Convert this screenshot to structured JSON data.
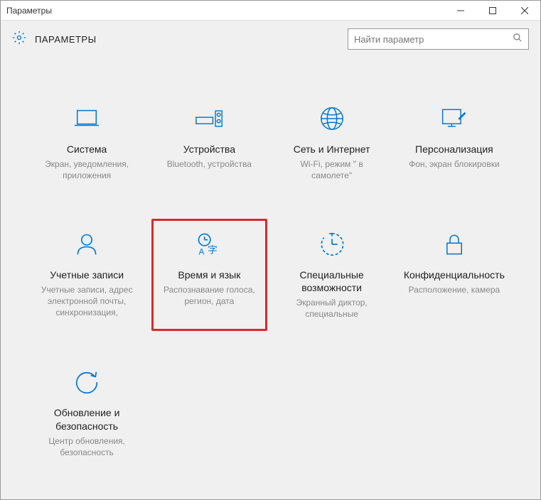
{
  "titlebar": {
    "title": "Параметры"
  },
  "header": {
    "title": "ПАРАМЕТРЫ"
  },
  "search": {
    "placeholder": "Найти параметр"
  },
  "tiles": {
    "system": {
      "title": "Система",
      "desc": "Экран, уведомления, приложения"
    },
    "devices": {
      "title": "Устройства",
      "desc": "Bluetooth, устройства"
    },
    "network": {
      "title": "Сеть и Интернет",
      "desc": "Wi-Fi, режим \" в самолете\""
    },
    "personalization": {
      "title": "Персонализация",
      "desc": "Фон, экран блокировки"
    },
    "accounts": {
      "title": "Учетные записи",
      "desc": "Учетные записи, адрес электронной почты, синхронизация,"
    },
    "time": {
      "title": "Время и язык",
      "desc": "Распознавание голоса, регион, дата"
    },
    "ease": {
      "title": "Специальные возможности",
      "desc": "Экранный диктор, специальные"
    },
    "privacy": {
      "title": "Конфиденциальность",
      "desc": "Расположение, камера"
    },
    "update": {
      "title": "Обновление и безопасность",
      "desc": "Центр обновления, безопасность"
    }
  }
}
